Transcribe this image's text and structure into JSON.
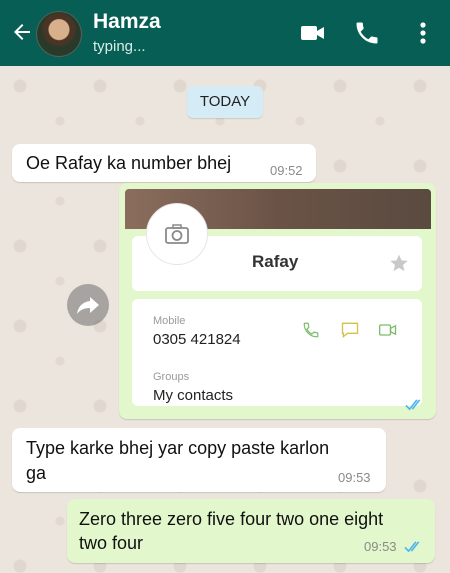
{
  "header": {
    "contact_name": "Hamza",
    "status": "typing..."
  },
  "chat": {
    "date_label": "TODAY",
    "messages": [
      {
        "text": "Oe Rafay ka number bhej",
        "time": "09:52"
      },
      {
        "text_line1": "Type karke bhej yar copy paste karlon",
        "text_line2": "ga",
        "time": "09:53"
      },
      {
        "text_line1": "Zero three zero five four two one eight",
        "text_line2": "two four",
        "time": "09:53"
      }
    ],
    "contact_card": {
      "name": "Rafay",
      "phone_label": "Mobile",
      "phone": "0305 421824",
      "groups_label": "Groups",
      "group": "My contacts"
    }
  },
  "colors": {
    "header_bg": "#075e54",
    "outgoing_bubble": "#e2f7cb",
    "incoming_bubble": "#ffffff",
    "read_ticks": "#4fb6ec",
    "contact_action": "#7dbb6a"
  }
}
